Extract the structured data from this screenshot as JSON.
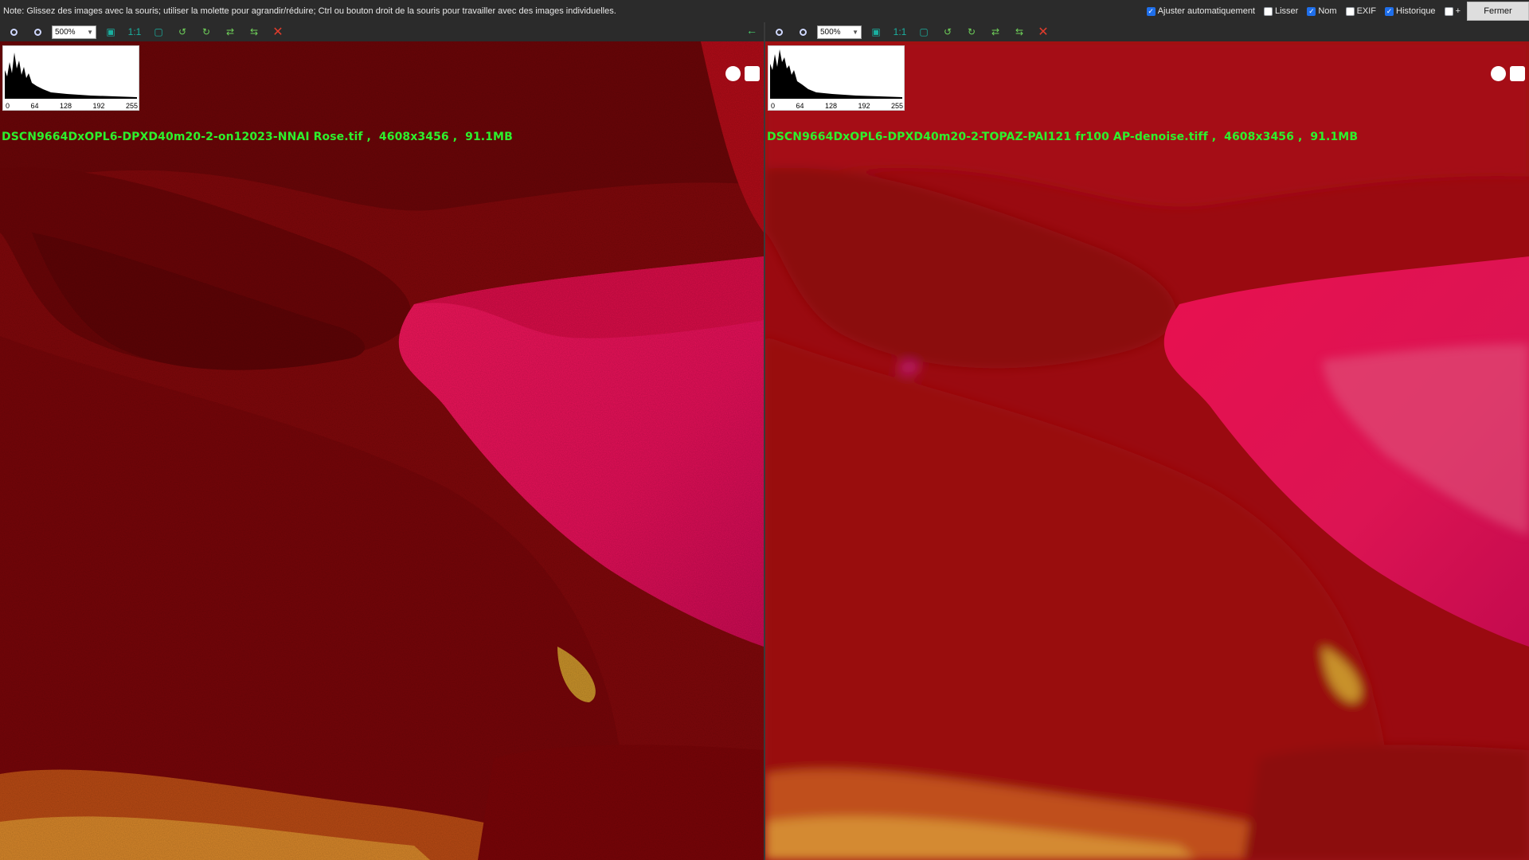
{
  "topbar": {
    "note": "Note: Glissez des images avec la souris; utiliser la molette pour agrandir/réduire; Ctrl ou bouton droit de la souris pour travailler avec des images individuelles.",
    "options": [
      {
        "label": "Ajuster automatiquement",
        "checked": true
      },
      {
        "label": "Lisser",
        "checked": false
      },
      {
        "label": "Nom",
        "checked": true
      },
      {
        "label": "EXIF",
        "checked": false
      },
      {
        "label": "Historique",
        "checked": true
      },
      {
        "label": "+",
        "checked": false
      }
    ],
    "close_label": "Fermer"
  },
  "panes": [
    {
      "zoom": "500%",
      "ratio_label": "1:1",
      "filename": "DSCN9664DxOPL6-DPXD40m20-2-on12023-NNAI Rose.tif",
      "dimensions": "4608x3456",
      "size": "91.1MB",
      "histogram_ticks": [
        "0",
        "64",
        "128",
        "192",
        "255"
      ]
    },
    {
      "zoom": "500%",
      "ratio_label": "1:1",
      "filename": "DSCN9664DxOPL6-DPXD40m20-2-TOPAZ-PAI121 fr100 AP-denoise.tiff",
      "dimensions": "4608x3456",
      "size": "91.1MB",
      "histogram_ticks": [
        "0",
        "64",
        "128",
        "192",
        "255"
      ]
    }
  ],
  "caption_separator": " ,  ",
  "colors": {
    "caption_text": "#2df12d",
    "checkbox_on": "#1f6feb",
    "petal_dark": "#8a0a0c",
    "petal_pink": "#e8104f"
  }
}
